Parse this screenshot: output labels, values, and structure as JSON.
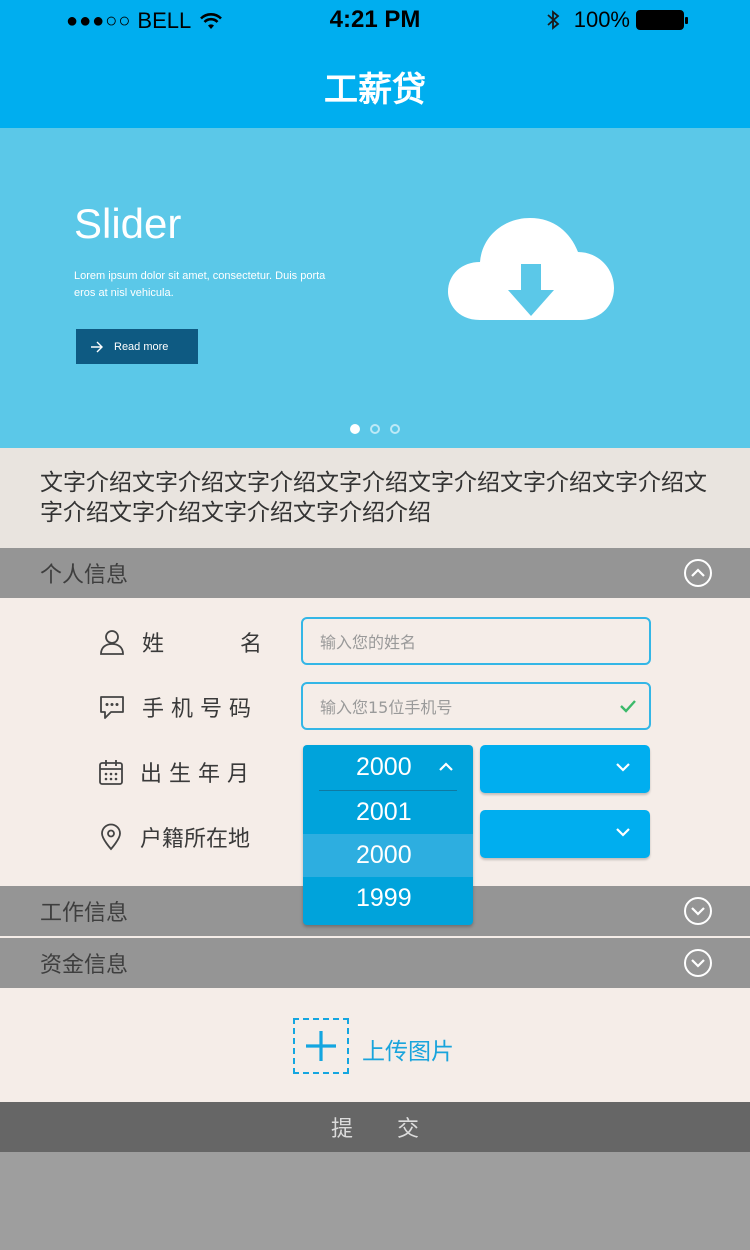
{
  "status_bar": {
    "signal": "●●●○○",
    "carrier": "BELL",
    "time": "4:21 PM",
    "battery": "100%"
  },
  "header": {
    "title": "工薪贷"
  },
  "slider": {
    "heading": "Slider",
    "text": "Lorem ipsum dolor sit amet, consectetur. Duis porta eros at nisl vehicula.",
    "button_label": "Read more",
    "active_page": 1,
    "page_count": 3
  },
  "intro": {
    "text": "文字介绍文字介绍文字介绍文字介绍文字介绍文字介绍文字介绍文字介绍文字介绍文字介绍文字介绍介绍"
  },
  "sections": {
    "personal": "个人信息",
    "work": "工作信息",
    "funds": "资金信息"
  },
  "form": {
    "name_label_1": "姓",
    "name_label_2": "名",
    "name_placeholder": "输入您的姓名",
    "phone_label": "手 机 号 码",
    "phone_placeholder": "输入您15位手机号",
    "birth_label": "出 生 年 月",
    "hukou_label": "户籍所在地"
  },
  "year_dropdown": {
    "selected": "2000",
    "options": [
      "2001",
      "2000",
      "1999"
    ],
    "highlighted": "2000"
  },
  "upload": {
    "label": "上传图片"
  },
  "submit": {
    "label": "提交"
  },
  "colors": {
    "accent": "#00aeef",
    "section_bar": "#959595",
    "form_bg": "#f5ede8",
    "submit_bg": "#666666"
  }
}
